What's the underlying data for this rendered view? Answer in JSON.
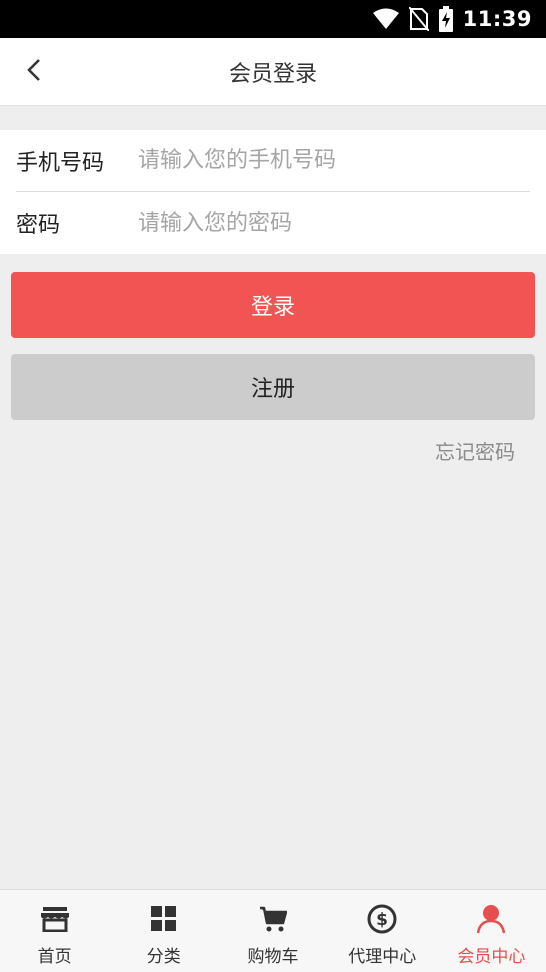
{
  "status_bar": {
    "time": "11:39",
    "icons": [
      "wifi-icon",
      "no-sim-icon",
      "battery-charging-icon"
    ]
  },
  "header": {
    "title": "会员登录",
    "back_icon": "chevron-left-icon"
  },
  "form": {
    "phone_label": "手机号码",
    "phone_placeholder": "请输入您的手机号码",
    "phone_value": "",
    "password_label": "密码",
    "password_placeholder": "请输入您的密码",
    "password_value": ""
  },
  "actions": {
    "login_label": "登录",
    "register_label": "注册",
    "forgot_label": "忘记密码"
  },
  "tabbar": {
    "items": [
      {
        "label": "首页",
        "icon": "store-icon",
        "active": false
      },
      {
        "label": "分类",
        "icon": "grid-icon",
        "active": false
      },
      {
        "label": "购物车",
        "icon": "cart-icon",
        "active": false
      },
      {
        "label": "代理中心",
        "icon": "dollar-circle-icon",
        "active": false
      },
      {
        "label": "会员中心",
        "icon": "user-icon",
        "active": true
      }
    ]
  },
  "colors": {
    "accent": "#f25454",
    "tab_active": "#e84e4e",
    "register_bg": "#cccccc",
    "page_bg": "#eeeeee"
  }
}
